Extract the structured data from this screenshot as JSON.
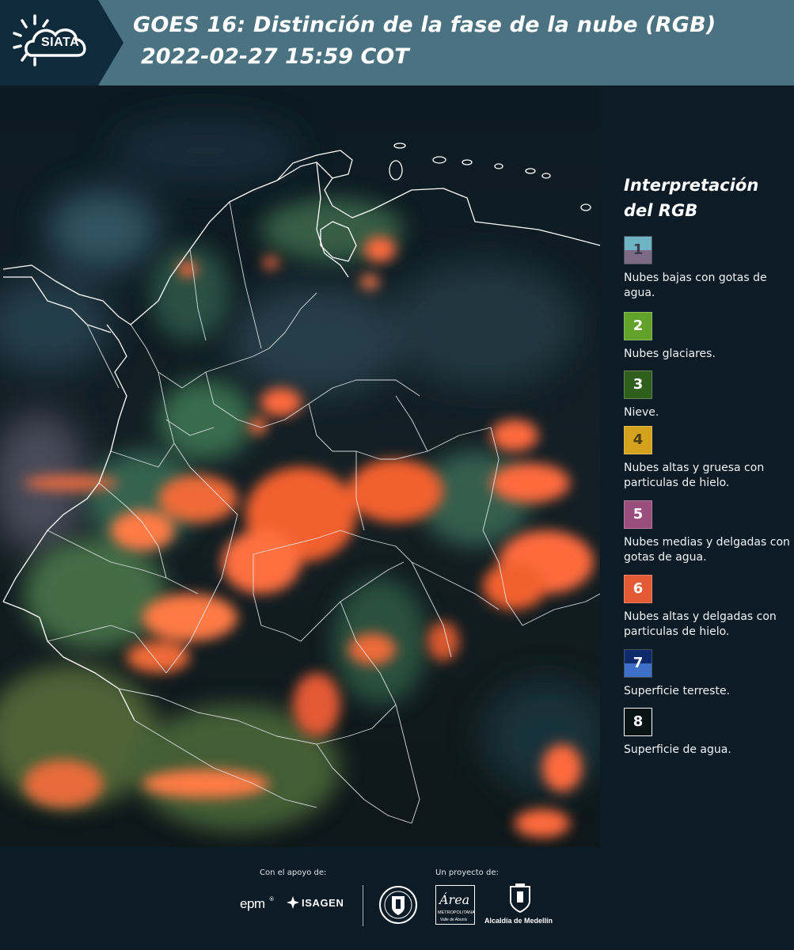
{
  "header": {
    "brand": "SIATA",
    "title_line1": "GOES 16: Distinción de la fase de la nube (RGB)",
    "title_line2": "2022-02-27 15:59 COT",
    "colors": {
      "background": "#4b7281",
      "logo_block": "#0f2a3a"
    }
  },
  "legend": {
    "title": "Interpretación del RGB",
    "items": [
      {
        "number": "1",
        "label": "Nubes bajas con gotas de agua.",
        "color_top": "#6fb4c4",
        "color_bottom": "#7d6b85"
      },
      {
        "number": "2",
        "label": "Nubes glaciares.",
        "color": "#62a22b"
      },
      {
        "number": "3",
        "label": "Nieve.",
        "color": "#2f5e1d"
      },
      {
        "number": "4",
        "label": "Nubes altas y gruesa con particulas de hielo.",
        "color": "#d4a21c"
      },
      {
        "number": "5",
        "label": "Nubes medias y delgadas con gotas de agua.",
        "color": "#9a4e7d"
      },
      {
        "number": "6",
        "label": "Nubes altas y delgadas con particulas de hielo.",
        "color": "#e35a34"
      },
      {
        "number": "7",
        "label": "Superficie terreste.",
        "color_top": "#0d2a6c",
        "color_bottom": "#3f70c9"
      },
      {
        "number": "8",
        "label": "Superficie de agua.",
        "color": "#0a1412"
      }
    ]
  },
  "footer": {
    "support_caption": "Con el apoyo de:",
    "project_caption": "Un proyecto de:",
    "logos": {
      "epm": "epm",
      "isagen": "ISAGEN",
      "area_metropolitana": "Área",
      "area_sub": "METROPOLITANA",
      "area_sub2": "Valle de Aburrá",
      "alcaldia": "Alcaldía de Medellín"
    }
  }
}
